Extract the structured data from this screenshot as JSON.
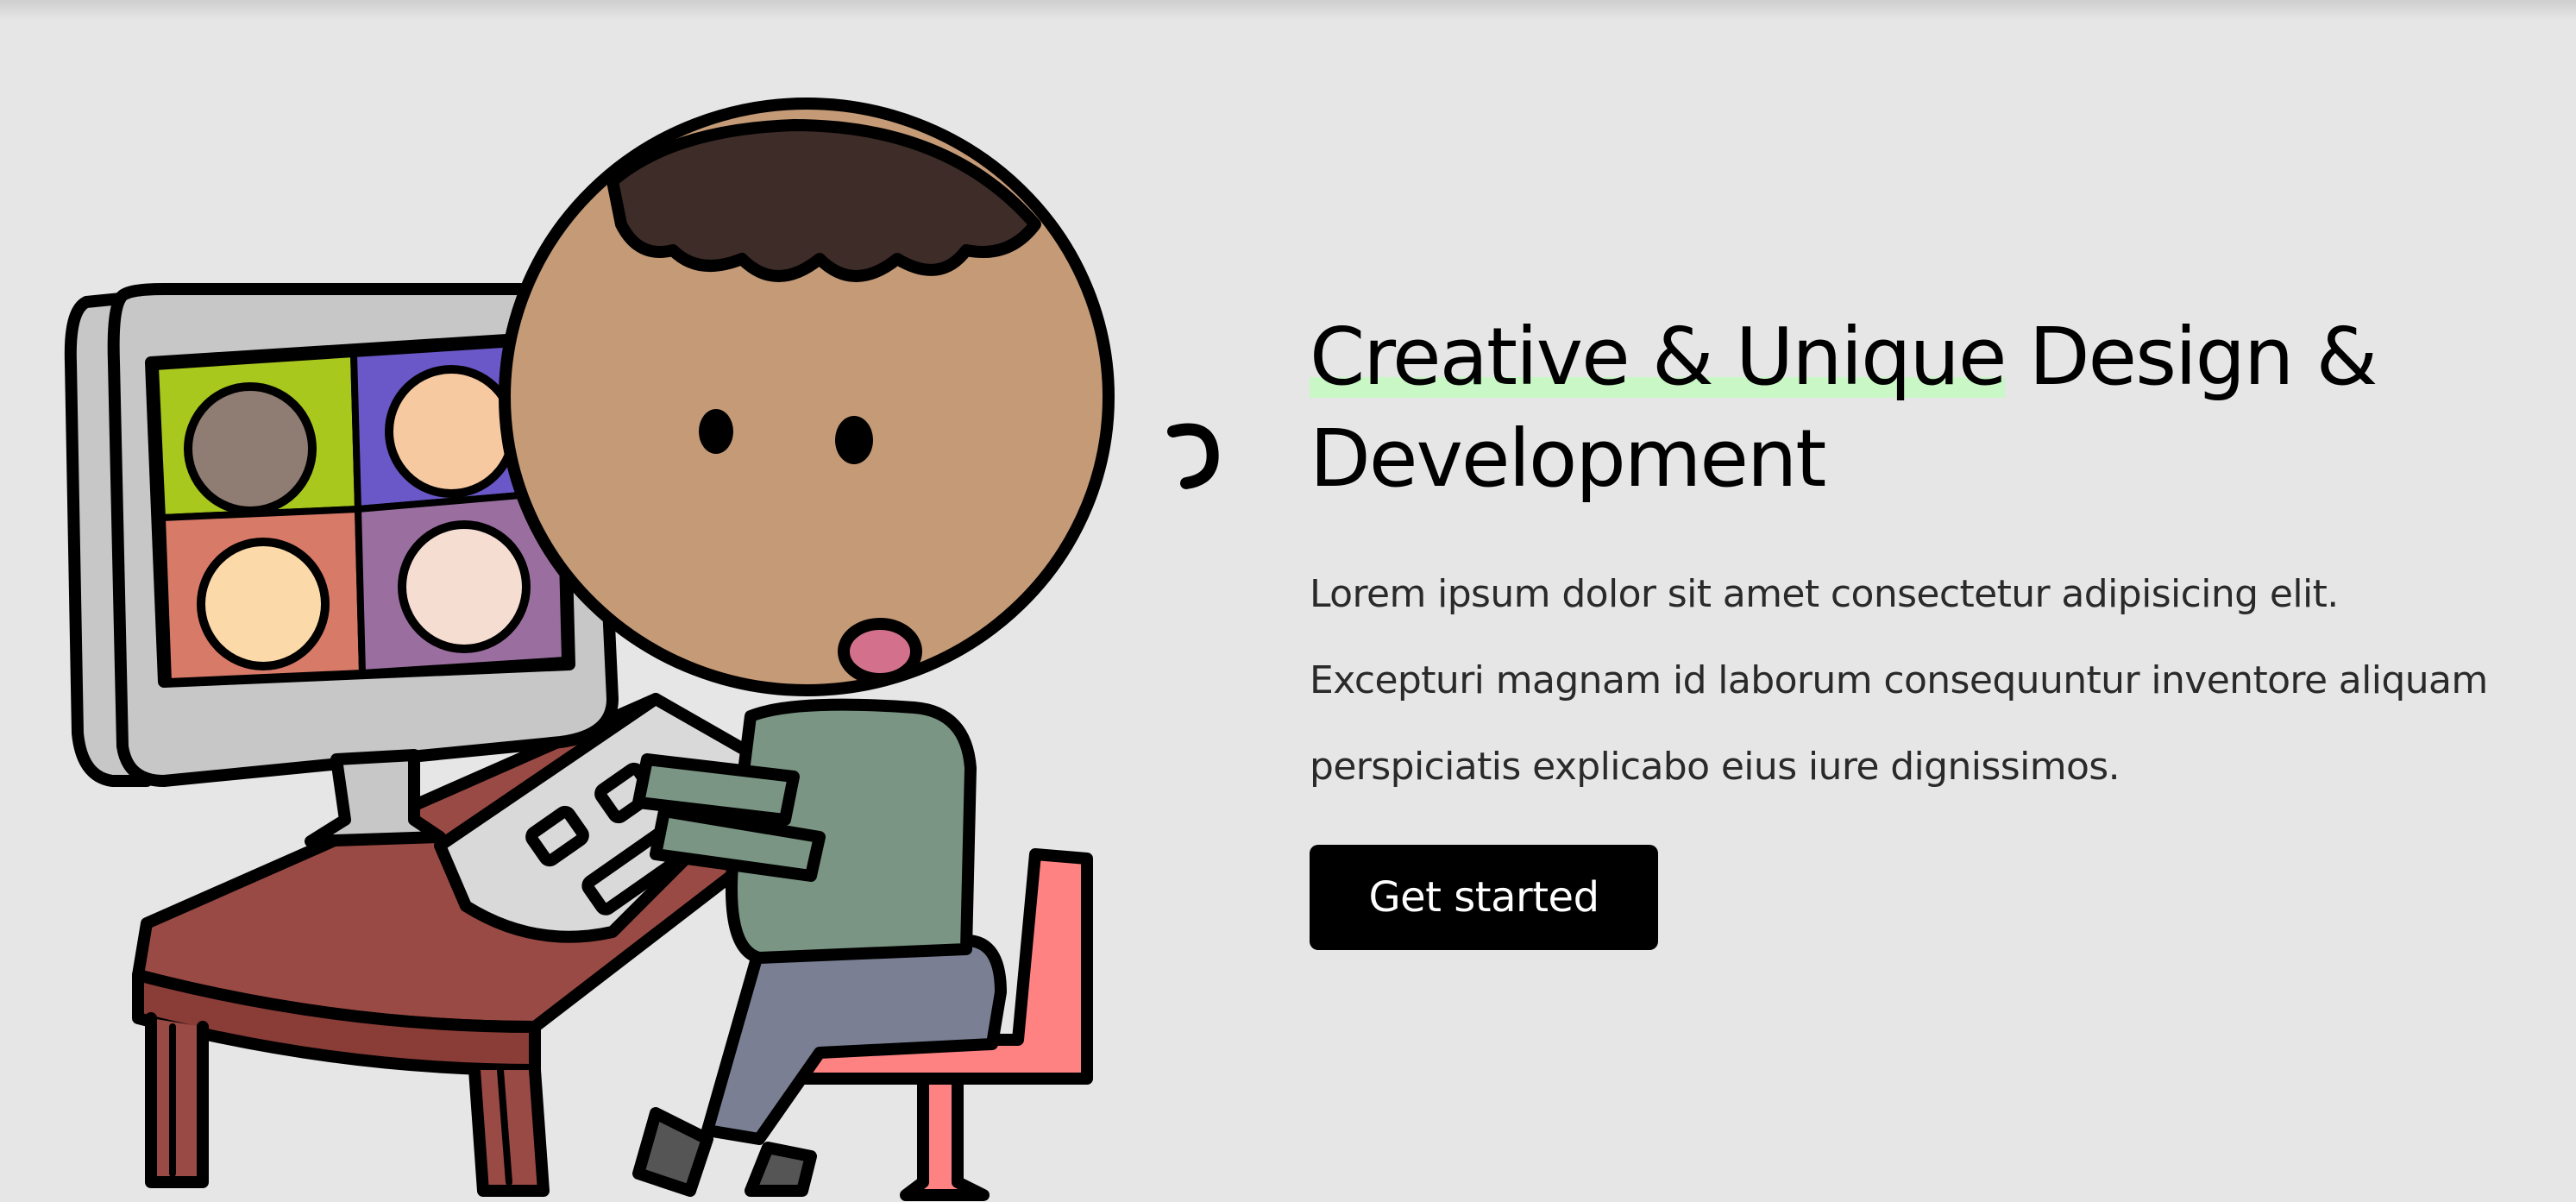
{
  "hero": {
    "headline_highlight": "Creative & Unique",
    "headline_rest": " Design &",
    "headline_line2": "Development",
    "description_lines": [
      "Lorem ipsum dolor sit amet consectetur adipisicing elit.",
      "Excepturi magnam id laborum consequuntur inventore aliquam",
      "perspiciatis explicabo eius iure dignissimos."
    ],
    "cta_label": "Get started"
  },
  "colors": {
    "background": "#e6e6e6",
    "headline_highlight": "#c9f7c6",
    "cta_background": "#000000",
    "cta_text": "#ffffff"
  },
  "illustration": {
    "subject": "person-at-computer-video-call"
  }
}
